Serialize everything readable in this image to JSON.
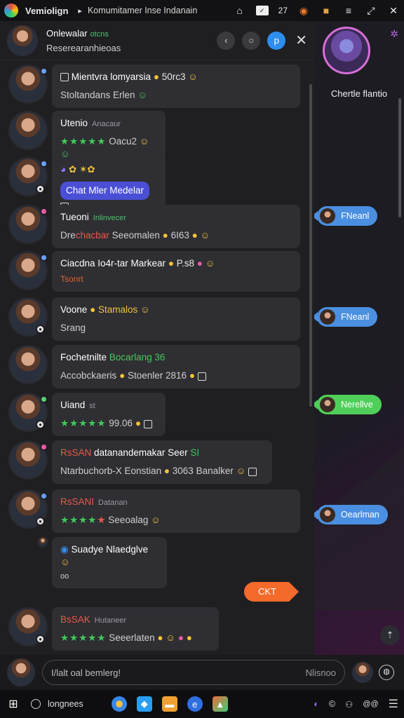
{
  "topbar": {
    "app_title": "Vemiolign",
    "breadcrumb_arrow": "▸",
    "breadcrumb": "Komumitamer Inse Indanain",
    "counter": "27",
    "icons": [
      "house-icon",
      "terminal-icon",
      "app-icon",
      "cube-icon",
      "menu-icon",
      "pip-icon",
      "close-icon"
    ]
  },
  "chat_header": {
    "title": "Onlewalar",
    "subtitle_badge": "otcns",
    "subtitle": "Reserearanhieoas",
    "btn_minimize": "‹",
    "btn_circle": "○",
    "btn_blue": "p",
    "close": "✕"
  },
  "messages": [
    {
      "name": "Mientvra lomyarsia",
      "extra": "50rc3",
      "line2": "Stoltandans Erlen"
    },
    {
      "name": "Utenio",
      "tag": "Anacaur",
      "line2_stars": "★★★★★",
      "line2": "Oacu2"
    },
    {
      "pill": "Chat Mler Medelar",
      "icons_line": "✿ ✶✿"
    },
    {
      "name": "Tueoni",
      "tag": "Inlinvecer",
      "line2_prefix": "Dre",
      "line2_red": "chacbar",
      "line2": "Seeomalen",
      "extra": "6I63"
    },
    {
      "name": "Ciacdna Io4r-tar Markear",
      "extra": "P.s8",
      "line2": "Tsonrt"
    },
    {
      "name": "Voone",
      "highlight": "Stamalos",
      "line2": "Srang"
    },
    {
      "name": "Fochetnilte",
      "tag": "Bocarlang 36",
      "line2": "Accobckaeris",
      "extra": "Stoenler 2816"
    },
    {
      "name": "Uiand",
      "tag": "st",
      "line2_stars": "★★★★★",
      "line2": "99.06"
    },
    {
      "name": "RsSAN",
      "tag": "datanandemakar Seer",
      "tag2": "SI",
      "line2": "Ntarbuchorb-X Eonstian",
      "extra": "3063",
      "extra2": "Banalker"
    },
    {
      "name": "RsSANI",
      "tag": "Datanan",
      "line2_stars": "★★★★",
      "line2_red": "★",
      "line2": "Seeoalag"
    },
    {
      "name": "Suadye Nlaedglve",
      "line2": "oo"
    },
    {
      "name": "BsSAK",
      "tag": "Hutaneer",
      "line2_stars": "★★★★★",
      "line2": "Seeerlaten"
    }
  ],
  "cta_button": "CKT",
  "right_panel": {
    "profile_name": "Chertle flantio",
    "tags": [
      {
        "label": "FNeanl",
        "color": "#4a8fe0"
      },
      {
        "label": "FNeanl",
        "color": "#4a8fe0"
      },
      {
        "label": "Nerellve",
        "color": "#4fcf5a"
      },
      {
        "label": "Oearlman",
        "color": "#4a8fe0"
      }
    ],
    "up_icon": "⇡"
  },
  "composer": {
    "placeholder": "I/lalt oal bemlerg!",
    "right_label": "Nlisnoo",
    "mic": "◍"
  },
  "taskbar": {
    "search_label": "longnees",
    "tray_time": "@@"
  }
}
